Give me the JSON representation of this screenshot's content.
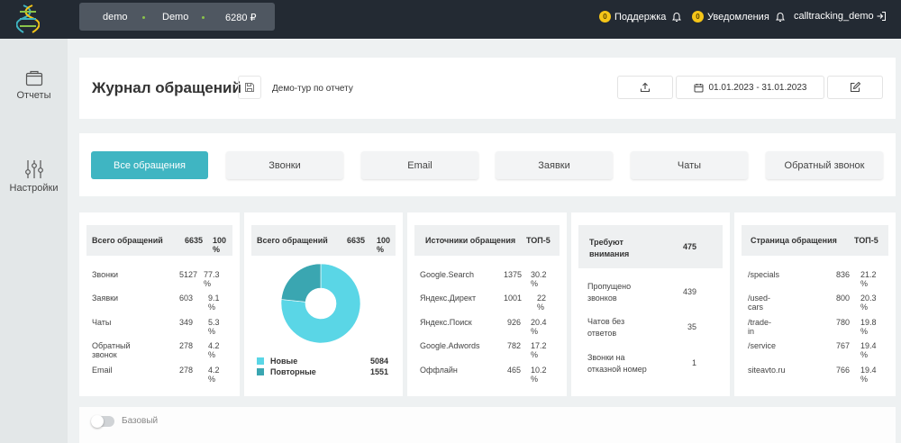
{
  "topbar": {
    "account": {
      "login": "demo",
      "project": "Demo",
      "balance": "6280 ₽"
    },
    "support": {
      "badge": "0",
      "label": "Поддержка",
      "icon": "bell-icon"
    },
    "notifications": {
      "badge": "0",
      "label": "Уведомления",
      "icon": "bell-icon"
    },
    "user": "calltracking_demo",
    "logout_icon": "logout-icon"
  },
  "sidebar": {
    "items": [
      {
        "label": "Отчеты",
        "icon": "folder-icon"
      },
      {
        "label": "Настройки",
        "icon": "sliders-icon"
      }
    ]
  },
  "header": {
    "title": "Журнал обращений",
    "demo_tour": "Демо-тур по отчету",
    "date_range": "01.01.2023 - 31.01.2023"
  },
  "tabs": [
    {
      "label": "Все обращения",
      "active": true
    },
    {
      "label": "Звонки",
      "active": false
    },
    {
      "label": "Email",
      "active": false
    },
    {
      "label": "Заявки",
      "active": false
    },
    {
      "label": "Чаты",
      "active": false
    },
    {
      "label": "Обратный звонок",
      "active": false
    }
  ],
  "summary": {
    "head": {
      "label": "Всего обращений",
      "value": "6635",
      "pct": "100 %"
    },
    "rows": [
      {
        "label": "Звонки",
        "value": "5127",
        "pct": "77.3 %"
      },
      {
        "label": "Заявки",
        "value": "603",
        "pct": "9.1 %"
      },
      {
        "label": "Чаты",
        "value": "349",
        "pct": "5.3 %"
      },
      {
        "label": "Обратный звонок",
        "value": "278",
        "pct": "4.2 %"
      },
      {
        "label": "Email",
        "value": "278",
        "pct": "4.2 %"
      }
    ]
  },
  "donut": {
    "head": {
      "label": "Всего обращений",
      "value": "6635",
      "pct": "100 %"
    },
    "legend": [
      {
        "label": "Новые",
        "value": "5084"
      },
      {
        "label": "Повторные",
        "value": "1551"
      }
    ]
  },
  "chart_data": {
    "type": "pie",
    "categories": [
      "Новые",
      "Повторные"
    ],
    "values": [
      5084,
      1551
    ],
    "colors": [
      "#5ad6e6",
      "#3aa6b1"
    ]
  },
  "sources": {
    "head": {
      "label": "Источники обращения",
      "value": "ТОП-5"
    },
    "rows": [
      {
        "label": "Google.Search",
        "value": "1375",
        "pct": "30.2 %"
      },
      {
        "label": "Яндекс.Директ",
        "value": "1001",
        "pct": "22 %"
      },
      {
        "label": "Яндекс.Поиск",
        "value": "926",
        "pct": "20.4 %"
      },
      {
        "label": "Google.Adwords",
        "value": "782",
        "pct": "17.2 %"
      },
      {
        "label": "Оффлайн",
        "value": "465",
        "pct": "10.2 %"
      }
    ]
  },
  "attention": {
    "head": {
      "label": "Требуют внимания",
      "value": "475"
    },
    "rows": [
      {
        "label": "Пропущено звонков",
        "value": "439"
      },
      {
        "label": "Чатов без ответов",
        "value": "35"
      },
      {
        "label": "Звонки на отказной номер",
        "value": "1"
      }
    ]
  },
  "pages": {
    "head": {
      "label": "Страница обращения",
      "value": "ТОП-5"
    },
    "rows": [
      {
        "label": "/specials",
        "value": "836",
        "pct": "21.2 %"
      },
      {
        "label": "/used-cars",
        "value": "800",
        "pct": "20.3 %"
      },
      {
        "label": "/trade-in",
        "value": "780",
        "pct": "19.8 %"
      },
      {
        "label": "/service",
        "value": "767",
        "pct": "19.4 %"
      },
      {
        "label": "siteavto.ru",
        "value": "766",
        "pct": "19.4 %"
      }
    ]
  },
  "base_toggle": {
    "label": "Базовый",
    "on": false
  },
  "colors": {
    "accent": "#3fb5c2",
    "topbar": "#232a33",
    "coin": "#f5c518"
  }
}
